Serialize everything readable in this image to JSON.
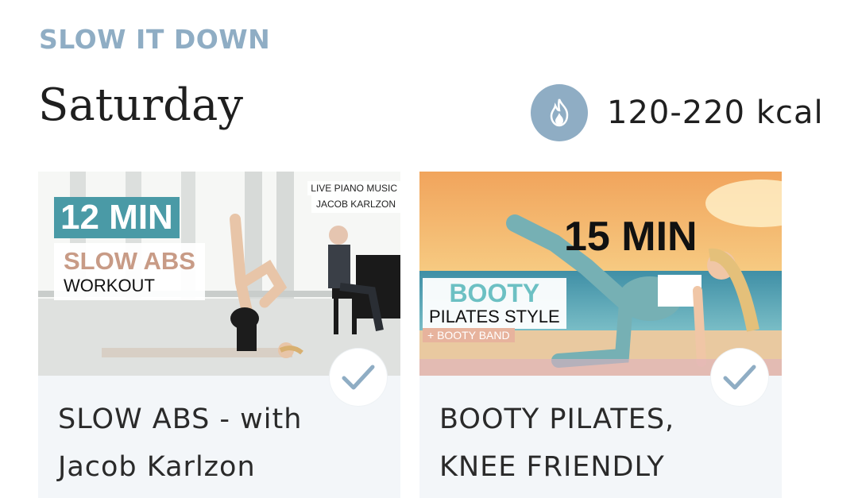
{
  "section": {
    "eyebrow": "SLOW IT DOWN",
    "day": "Saturday"
  },
  "calories": {
    "icon": "flame-icon",
    "text": "120-220 kcal"
  },
  "colors": {
    "accent": "#8fadc4",
    "card_bg": "#f3f6f9",
    "teal": "#4a9aa6"
  },
  "cards": [
    {
      "title_line1": "SLOW ABS - with",
      "title_line2": "Jacob Karlzon",
      "completed": true,
      "thumb": {
        "duration": "12 MIN",
        "heading": "SLOW ABS",
        "subheading": "WORKOUT",
        "music_label": "LIVE PIANO MUSIC",
        "music_artist": "JACOB KARLZON"
      }
    },
    {
      "title_line1": "BOOTY PILATES,",
      "title_line2": "KNEE FRIENDLY",
      "completed": true,
      "thumb": {
        "duration": "15 MIN",
        "heading": "BOOTY",
        "subheading": "PILATES STYLE",
        "extra": "+ BOOTY BAND"
      }
    }
  ]
}
